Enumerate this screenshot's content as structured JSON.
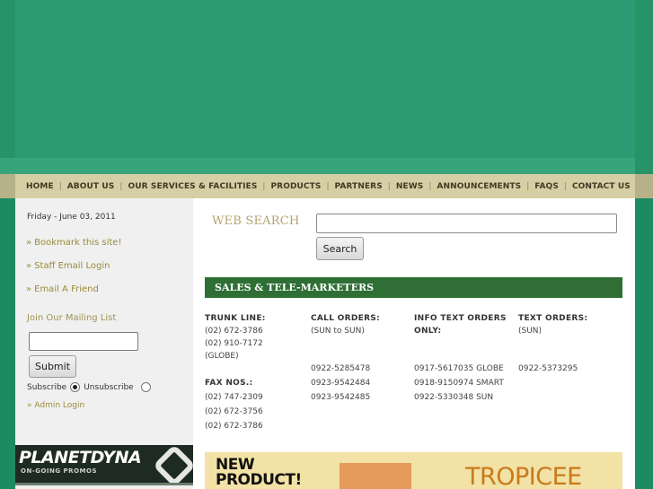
{
  "nav": {
    "items": [
      "HOME",
      "ABOUT US",
      "OUR SERVICES & FACILITIES",
      "PRODUCTS",
      "PARTNERS",
      "NEWS",
      "ANNOUNCEMENTS",
      "FAQs",
      "CONTACT US"
    ],
    "separator": "|"
  },
  "sidebar": {
    "date": "Friday - June 03, 2011",
    "arrow": "»",
    "links": [
      "Bookmark this site!",
      "Staff Email Login",
      "Email A Friend"
    ],
    "mailing_title": "Join Our Mailing List",
    "submit_label": "Submit",
    "subscribe_label": "Subscribe",
    "unsubscribe_label": "Unsubscribe",
    "admin_label": "» Admin Login",
    "promo_title": "PLANETDYNA",
    "promo_sub": "ON-GOING PROMOS"
  },
  "search": {
    "label": "WEB SEARCH",
    "button_label": "Search",
    "value": ""
  },
  "sales": {
    "title": "SALES & TELE-MARKETERS",
    "trunk_head": "TRUNK LINE:",
    "trunk_lines": [
      "(02) 672-3786",
      "(02) 910-7172",
      "(GLOBE)"
    ],
    "fax_head": "FAX NOS.:",
    "fax_lines": [
      "(02) 747-2309",
      "(02) 672-3756",
      "(02) 672-3786"
    ],
    "call_head": "CALL ORDERS:",
    "call_sub": "(SUN to SUN)",
    "call_lines": [
      "0922-5285478",
      "0923-9542484",
      "0923-9542485"
    ],
    "info_head_1": "INFO TEXT ORDERS",
    "info_head_2": "ONLY:",
    "info_lines": [
      "0917-5617035 GLOBE",
      "0918-9150974 SMART",
      "0922-5330348 SUN"
    ],
    "text_head": "TEXT ORDERS:",
    "text_sub": "(SUN)",
    "text_lines": [
      "0922-5373295"
    ]
  },
  "banner": {
    "left_1": "NEW",
    "left_2": "PRODUCT!",
    "right": "TROPICEE"
  }
}
